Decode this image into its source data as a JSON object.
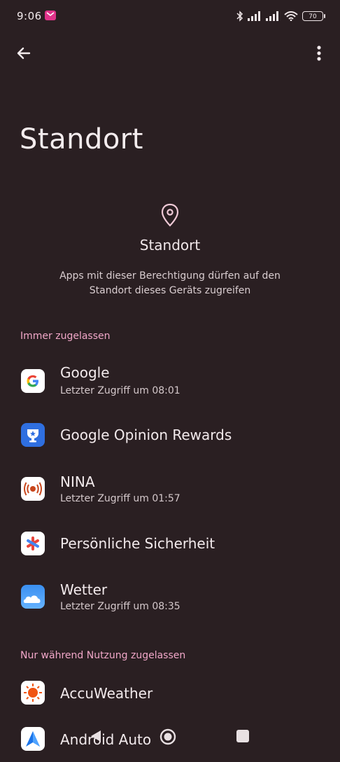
{
  "status_bar": {
    "time": "9:06",
    "battery": "70",
    "icons": [
      "mail-icon",
      "bluetooth-icon",
      "signal-icon",
      "signal-icon",
      "wifi-icon",
      "battery-icon"
    ]
  },
  "top_bar": {
    "back_icon": "arrow-left-icon",
    "more_icon": "more-vertical-icon"
  },
  "page": {
    "title": "Standort",
    "hero_title": "Standort",
    "hero_description": "Apps mit dieser Berechtigung dürfen auf den Standort dieses Geräts zugreifen",
    "hero_icon": "location-pin-icon"
  },
  "sections": [
    {
      "header": "Immer zugelassen",
      "apps": [
        {
          "name": "Google",
          "subtitle": "Letzter Zugriff um 08:01",
          "icon": "google-icon"
        },
        {
          "name": "Google Opinion Rewards",
          "subtitle": "",
          "icon": "google-opinion-rewards-icon"
        },
        {
          "name": "NINA",
          "subtitle": "Letzter Zugriff um 01:57",
          "icon": "nina-icon"
        },
        {
          "name": "Persönliche Sicherheit",
          "subtitle": "",
          "icon": "personal-safety-icon"
        },
        {
          "name": "Wetter",
          "subtitle": "Letzter Zugriff um 08:35",
          "icon": "weather-icon"
        }
      ]
    },
    {
      "header": "Nur während Nutzung zugelassen",
      "apps": [
        {
          "name": "AccuWeather",
          "subtitle": "",
          "icon": "accuweather-icon"
        },
        {
          "name": "Android Auto",
          "subtitle": "",
          "icon": "android-auto-icon"
        }
      ]
    }
  ],
  "colors": {
    "background": "#2a1f22",
    "accent": "#f1a7c8",
    "text": "#f2eaec"
  }
}
